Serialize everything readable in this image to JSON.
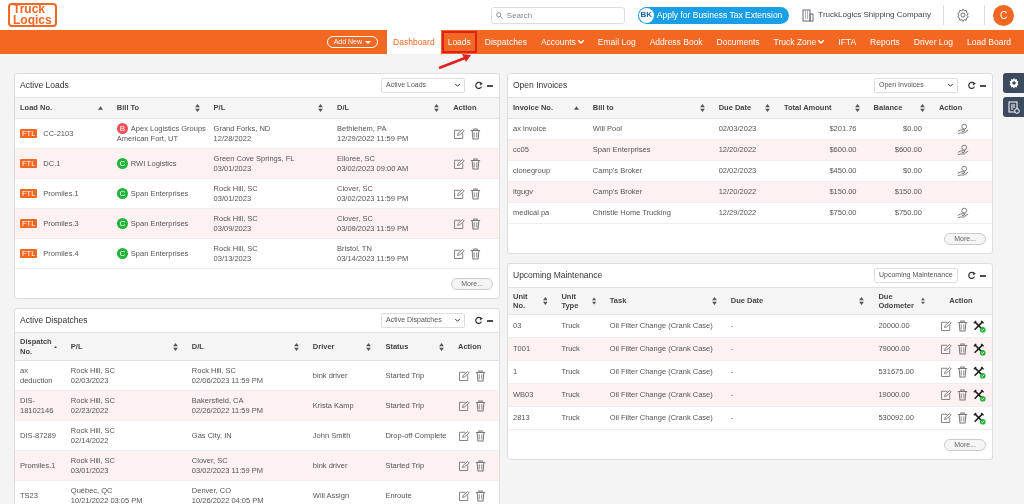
{
  "header": {
    "logo": [
      "Truck",
      "Logics"
    ],
    "search": {
      "placeholder": "Search"
    },
    "tax_button": {
      "badge": "BK",
      "label": "Apply for Business Tax Extension"
    },
    "company": "TruckLogics Shipping Company",
    "avatar": "C"
  },
  "nav": {
    "add_new": "Add New",
    "items": [
      {
        "label": "Dashboard",
        "selected": true,
        "dropdown": false,
        "highlighted": false
      },
      {
        "label": "Loads",
        "selected": false,
        "dropdown": false,
        "highlighted": true
      },
      {
        "label": "Dispatches",
        "selected": false,
        "dropdown": false,
        "highlighted": false
      },
      {
        "label": "Accounts",
        "selected": false,
        "dropdown": true,
        "highlighted": false
      },
      {
        "label": "Email Log",
        "selected": false,
        "dropdown": false,
        "highlighted": false
      },
      {
        "label": "Address Book",
        "selected": false,
        "dropdown": false,
        "highlighted": false
      },
      {
        "label": "Documents",
        "selected": false,
        "dropdown": false,
        "highlighted": false
      },
      {
        "label": "Truck Zone",
        "selected": false,
        "dropdown": true,
        "highlighted": false
      },
      {
        "label": "IFTA",
        "selected": false,
        "dropdown": false,
        "highlighted": false
      },
      {
        "label": "Reports",
        "selected": false,
        "dropdown": false,
        "highlighted": false
      },
      {
        "label": "Driver Log",
        "selected": false,
        "dropdown": false,
        "highlighted": false
      },
      {
        "label": "Load Board",
        "selected": false,
        "dropdown": false,
        "highlighted": false
      }
    ]
  },
  "panels": [
    {
      "title": "Active Loads",
      "filter": "Active Loads",
      "more": "More...",
      "columns": [
        {
          "label": "Load No.",
          "kind": "sorted"
        },
        {
          "label": "Bill To",
          "kind": "sortable"
        },
        {
          "label": "P/L",
          "kind": "sortable"
        },
        {
          "label": "D/L",
          "kind": "sortable"
        },
        {
          "label": "Action",
          "kind": "plain"
        }
      ],
      "rows": [
        {
          "cells": [
            {
              "kind": "tag",
              "tag": "FTL",
              "lines": [
                "CC-2103"
              ]
            },
            {
              "kind": "badge",
              "badge": "B",
              "color": "#f0505a",
              "lines": [
                "Apex Logistics Groups",
                "American Fort, UT"
              ]
            },
            {
              "kind": "text",
              "lines": [
                "Grand Forks, ND",
                "12/28/2022"
              ]
            },
            {
              "kind": "text",
              "lines": [
                "Bethlehem, PA",
                "12/29/2022 11:59 PM"
              ]
            }
          ],
          "actions": [
            {
              "kind": "edit"
            },
            {
              "kind": "delete"
            }
          ]
        },
        {
          "cells": [
            {
              "kind": "tag",
              "tag": "FTL",
              "lines": [
                "DC.1"
              ]
            },
            {
              "kind": "badge",
              "badge": "C",
              "color": "#22b33a",
              "lines": [
                "RWI Logistics"
              ]
            },
            {
              "kind": "text",
              "lines": [
                "Green Cove Springs, FL",
                "03/01/2023"
              ]
            },
            {
              "kind": "text",
              "lines": [
                "Elloree, SC",
                "03/02/2023 09:00 AM"
              ]
            }
          ],
          "actions": [
            {
              "kind": "edit"
            },
            {
              "kind": "delete"
            }
          ]
        },
        {
          "cells": [
            {
              "kind": "tag",
              "tag": "FTL",
              "lines": [
                "Promiles.1"
              ]
            },
            {
              "kind": "badge",
              "badge": "C",
              "color": "#22b33a",
              "lines": [
                "Span Enterprises"
              ]
            },
            {
              "kind": "text",
              "lines": [
                "Rock Hill, SC",
                "03/01/2023"
              ]
            },
            {
              "kind": "text",
              "lines": [
                "Clover, SC",
                "03/02/2023 11:59 PM"
              ]
            }
          ],
          "actions": [
            {
              "kind": "edit"
            },
            {
              "kind": "delete"
            }
          ]
        },
        {
          "cells": [
            {
              "kind": "tag",
              "tag": "FTL",
              "lines": [
                "Promiles.3"
              ]
            },
            {
              "kind": "badge",
              "badge": "C",
              "color": "#22b33a",
              "lines": [
                "Span Enterprises"
              ]
            },
            {
              "kind": "text",
              "lines": [
                "Rock Hill, SC",
                "03/09/2023"
              ]
            },
            {
              "kind": "text",
              "lines": [
                "Clover, SC",
                "03/09/2023 11:59 PM"
              ]
            }
          ],
          "actions": [
            {
              "kind": "edit"
            },
            {
              "kind": "delete"
            }
          ]
        },
        {
          "cells": [
            {
              "kind": "tag",
              "tag": "FTL",
              "lines": [
                "Promiles.4"
              ]
            },
            {
              "kind": "badge",
              "badge": "C",
              "color": "#22b33a",
              "lines": [
                "Span Enterprises"
              ]
            },
            {
              "kind": "text",
              "lines": [
                "Rock Hill, SC",
                "03/13/2023"
              ]
            },
            {
              "kind": "text",
              "lines": [
                "Bristol, TN",
                "03/14/2023 11:59 PM"
              ]
            }
          ],
          "actions": [
            {
              "kind": "edit"
            },
            {
              "kind": "delete"
            }
          ]
        }
      ]
    },
    {
      "title": "Active Dispatches",
      "filter": "Active Dispatches",
      "columns": [
        {
          "label": "Dispatch No.",
          "kind": "sorted"
        },
        {
          "label": "P/L",
          "kind": "sortable"
        },
        {
          "label": "D/L",
          "kind": "sortable"
        },
        {
          "label": "Driver",
          "kind": "sortable"
        },
        {
          "label": "Status",
          "kind": "sortable"
        },
        {
          "label": "Action",
          "kind": "plain"
        }
      ],
      "rows": [
        {
          "cells": [
            {
              "kind": "text",
              "lines": [
                "ax",
                "deduction"
              ]
            },
            {
              "kind": "text",
              "lines": [
                "Rock Hill, SC",
                "02/03/2023"
              ]
            },
            {
              "kind": "text",
              "lines": [
                "Rock Hill, SC",
                "02/06/2023 11:59 PM"
              ]
            },
            {
              "kind": "text",
              "lines": [
                "bink driver"
              ]
            },
            {
              "kind": "text",
              "lines": [
                "Started Trip"
              ]
            }
          ],
          "actions": [
            {
              "kind": "edit"
            },
            {
              "kind": "delete"
            }
          ]
        },
        {
          "cells": [
            {
              "kind": "text",
              "lines": [
                "DIS-",
                "18102146"
              ]
            },
            {
              "kind": "text",
              "lines": [
                "Rock Hill, SC",
                "02/23/2022"
              ]
            },
            {
              "kind": "text",
              "lines": [
                "Bakersfield, CA",
                "02/26/2022 11:59 PM"
              ]
            },
            {
              "kind": "text",
              "lines": [
                "Krista Kamp"
              ]
            },
            {
              "kind": "text",
              "lines": [
                "Started Trip"
              ]
            }
          ],
          "actions": [
            {
              "kind": "edit"
            },
            {
              "kind": "delete"
            }
          ]
        },
        {
          "cells": [
            {
              "kind": "text",
              "lines": [
                "DIS-87289"
              ]
            },
            {
              "kind": "text",
              "lines": [
                "Rock Hill, SC",
                "02/14/2022"
              ]
            },
            {
              "kind": "text",
              "lines": [
                "Gas City, IN"
              ]
            },
            {
              "kind": "text",
              "lines": [
                "John Smith"
              ]
            },
            {
              "kind": "text",
              "lines": [
                "Drop-off Complete"
              ]
            }
          ],
          "actions": [
            {
              "kind": "edit"
            },
            {
              "kind": "delete"
            }
          ]
        },
        {
          "cells": [
            {
              "kind": "text",
              "lines": [
                "Promiles.1"
              ]
            },
            {
              "kind": "text",
              "lines": [
                "Rock Hill, SC",
                "03/01/2023"
              ]
            },
            {
              "kind": "text",
              "lines": [
                "Clover, SC",
                "03/02/2023 11:59 PM"
              ]
            },
            {
              "kind": "text",
              "lines": [
                "bink driver"
              ]
            },
            {
              "kind": "text",
              "lines": [
                "Started Trip"
              ]
            }
          ],
          "actions": [
            {
              "kind": "edit"
            },
            {
              "kind": "delete"
            }
          ]
        },
        {
          "cells": [
            {
              "kind": "text",
              "lines": [
                "TS23"
              ]
            },
            {
              "kind": "text",
              "lines": [
                "Québec, QC",
                "10/21/2022 03:05 PM"
              ]
            },
            {
              "kind": "text",
              "lines": [
                "Denver, CO",
                "10/26/2022 04:05 PM"
              ]
            },
            {
              "kind": "text",
              "lines": [
                "Will Assign"
              ]
            },
            {
              "kind": "text",
              "lines": [
                "Enroute"
              ]
            }
          ],
          "actions": [
            {
              "kind": "edit"
            },
            {
              "kind": "delete"
            }
          ]
        }
      ]
    },
    {
      "title": "Open Invoices",
      "filter": "Open Invoices",
      "more": "More...",
      "columns": [
        {
          "label": "Invoice No.",
          "kind": "sorted"
        },
        {
          "label": "Bill to",
          "kind": "sortable"
        },
        {
          "label": "Due Date",
          "kind": "sortable"
        },
        {
          "label": "Total Amount",
          "kind": "sortable"
        },
        {
          "label": "Balance",
          "kind": "sortable"
        },
        {
          "label": "Action",
          "kind": "plain"
        }
      ],
      "rows": [
        {
          "cells": [
            {
              "kind": "text",
              "lines": [
                "ax invoice"
              ]
            },
            {
              "kind": "text",
              "lines": [
                "Will Pool"
              ]
            },
            {
              "kind": "text",
              "lines": [
                "02/03/2023"
              ]
            },
            {
              "kind": "amount",
              "lines": [
                "$201.76"
              ]
            },
            {
              "kind": "amount",
              "lines": [
                "$0.00"
              ]
            }
          ],
          "actions": [
            {
              "kind": "payment"
            }
          ]
        },
        {
          "cells": [
            {
              "kind": "text",
              "lines": [
                "cc05"
              ]
            },
            {
              "kind": "text",
              "lines": [
                "Span Enterprises"
              ]
            },
            {
              "kind": "text",
              "lines": [
                "12/20/2022"
              ]
            },
            {
              "kind": "amount",
              "lines": [
                "$600.00"
              ]
            },
            {
              "kind": "amount",
              "lines": [
                "$600.00"
              ]
            }
          ],
          "actions": [
            {
              "kind": "payment"
            }
          ]
        },
        {
          "cells": [
            {
              "kind": "text",
              "lines": [
                "clonegroup"
              ]
            },
            {
              "kind": "text",
              "lines": [
                "Camp's Broker"
              ]
            },
            {
              "kind": "text",
              "lines": [
                "02/02/2023"
              ]
            },
            {
              "kind": "amount",
              "lines": [
                "$450.00"
              ]
            },
            {
              "kind": "amount",
              "lines": [
                "$0.00"
              ]
            }
          ],
          "actions": [
            {
              "kind": "payment"
            }
          ]
        },
        {
          "cells": [
            {
              "kind": "text",
              "lines": [
                "itgugv"
              ]
            },
            {
              "kind": "text",
              "lines": [
                "Camp's Broker"
              ]
            },
            {
              "kind": "text",
              "lines": [
                "12/20/2022"
              ]
            },
            {
              "kind": "amount",
              "lines": [
                "$150.00"
              ]
            },
            {
              "kind": "amount",
              "lines": [
                "$150.00"
              ]
            }
          ]
        },
        {
          "cells": [
            {
              "kind": "text",
              "lines": [
                "medical pa"
              ]
            },
            {
              "kind": "text",
              "lines": [
                "Christie Home Trucking"
              ]
            },
            {
              "kind": "text",
              "lines": [
                "12/29/2022"
              ]
            },
            {
              "kind": "amount",
              "lines": [
                "$750.00"
              ]
            },
            {
              "kind": "amount",
              "lines": [
                "$750.00"
              ]
            }
          ],
          "actions": [
            {
              "kind": "payment"
            }
          ]
        }
      ]
    },
    {
      "title": "Upcoming Maintenance",
      "filter": "Upcoming Maintenance",
      "more": "More...",
      "columns": [
        {
          "label": "Unit No.",
          "kind": "sortable"
        },
        {
          "label": "Unit Type",
          "kind": "sortable"
        },
        {
          "label": "Task",
          "kind": "sortable"
        },
        {
          "label": "Due Date",
          "kind": "sortable"
        },
        {
          "label": "Due Odometer",
          "kind": "sortable"
        },
        {
          "label": "Action",
          "kind": "plain"
        }
      ],
      "rows": [
        {
          "cells": [
            {
              "kind": "text",
              "lines": [
                "03"
              ]
            },
            {
              "kind": "text",
              "lines": [
                "Truck"
              ]
            },
            {
              "kind": "text",
              "lines": [
                "Oil Filter Change (Crank Case)"
              ]
            },
            {
              "kind": "text",
              "lines": [
                "-"
              ]
            },
            {
              "kind": "text",
              "lines": [
                "20000.00"
              ]
            }
          ],
          "actions": [
            {
              "kind": "edit"
            },
            {
              "kind": "delete"
            },
            {
              "kind": "service"
            }
          ]
        },
        {
          "cells": [
            {
              "kind": "text",
              "lines": [
                "T001"
              ]
            },
            {
              "kind": "text",
              "lines": [
                "Truck"
              ]
            },
            {
              "kind": "text",
              "lines": [
                "Oil Filter Change (Crank Case)"
              ]
            },
            {
              "kind": "text",
              "lines": [
                "-"
              ]
            },
            {
              "kind": "text",
              "lines": [
                "79000.00"
              ]
            }
          ],
          "actions": [
            {
              "kind": "edit"
            },
            {
              "kind": "delete"
            },
            {
              "kind": "service"
            }
          ]
        },
        {
          "cells": [
            {
              "kind": "text",
              "lines": [
                "1"
              ]
            },
            {
              "kind": "text",
              "lines": [
                "Truck"
              ]
            },
            {
              "kind": "text",
              "lines": [
                "Oil Filter Change (Crank Case)"
              ]
            },
            {
              "kind": "text",
              "lines": [
                "-"
              ]
            },
            {
              "kind": "text",
              "lines": [
                "531675.00"
              ]
            }
          ],
          "actions": [
            {
              "kind": "edit"
            },
            {
              "kind": "delete"
            },
            {
              "kind": "service"
            }
          ]
        },
        {
          "cells": [
            {
              "kind": "text",
              "lines": [
                "WB03"
              ]
            },
            {
              "kind": "text",
              "lines": [
                "Truck"
              ]
            },
            {
              "kind": "text",
              "lines": [
                "Oil Filter Change (Crank Case)"
              ]
            },
            {
              "kind": "text",
              "lines": [
                "-"
              ]
            },
            {
              "kind": "text",
              "lines": [
                "19000.00"
              ]
            }
          ],
          "actions": [
            {
              "kind": "edit"
            },
            {
              "kind": "delete"
            },
            {
              "kind": "service"
            }
          ]
        },
        {
          "cells": [
            {
              "kind": "text",
              "lines": [
                "2813"
              ]
            },
            {
              "kind": "text",
              "lines": [
                "Truck"
              ]
            },
            {
              "kind": "text",
              "lines": [
                "Oil Filter Change (Crank Case)"
              ]
            },
            {
              "kind": "text",
              "lines": [
                "-"
              ]
            },
            {
              "kind": "text",
              "lines": [
                "530092.00"
              ]
            }
          ],
          "actions": [
            {
              "kind": "edit"
            },
            {
              "kind": "delete"
            },
            {
              "kind": "service"
            }
          ]
        }
      ]
    }
  ]
}
